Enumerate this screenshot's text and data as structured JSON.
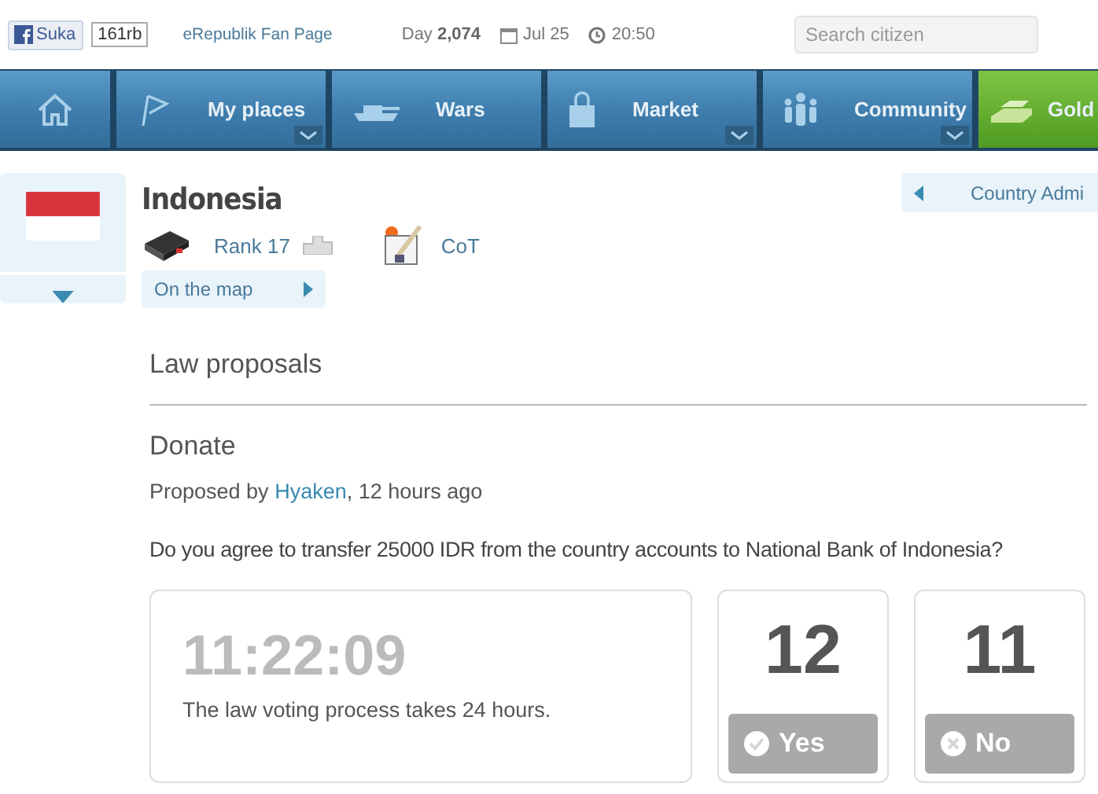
{
  "top_bar": {
    "like_button": "Suka",
    "like_count": "161rb",
    "fan_page_link": "eRepublik Fan Page",
    "day": "Day **2,074**",
    "date": "Jul 25",
    "time": "20:50",
    "search": {
      "placeholder": "Search citizen"
    }
  },
  "nav": [
    {
      "kind": "home",
      "dropdown": false
    },
    {
      "kind": "flag",
      "label": "My places",
      "dropdown": true
    },
    {
      "kind": "tank",
      "label": "Wars",
      "dropdown": false
    },
    {
      "kind": "bag",
      "label": "Market",
      "dropdown": true
    },
    {
      "kind": "people",
      "label": "Community",
      "dropdown": true
    },
    {
      "kind": "gold",
      "label": "Gold",
      "dropdown": false
    }
  ],
  "country": {
    "name": "Indonesia",
    "rank": "Rank 17",
    "party": "CoT",
    "map_link": "On the map",
    "admin_button": "Country Admi"
  },
  "section_title": "Law proposals",
  "proposal": {
    "title": "Donate",
    "proposed_by": "Proposed by",
    "author": "Hyaken",
    "age": ", 12 hours ago",
    "question": "Do you agree to transfer 25000 IDR from the country accounts to National Bank of Indonesia?",
    "countdown": "11:22:09",
    "note": "The law voting process takes 24 hours.",
    "votes": [
      {
        "kind": "yes",
        "count": "12",
        "label": "Yes",
        "disabled": true
      },
      {
        "kind": "no",
        "count": "11",
        "label": "No",
        "disabled": true
      }
    ]
  }
}
